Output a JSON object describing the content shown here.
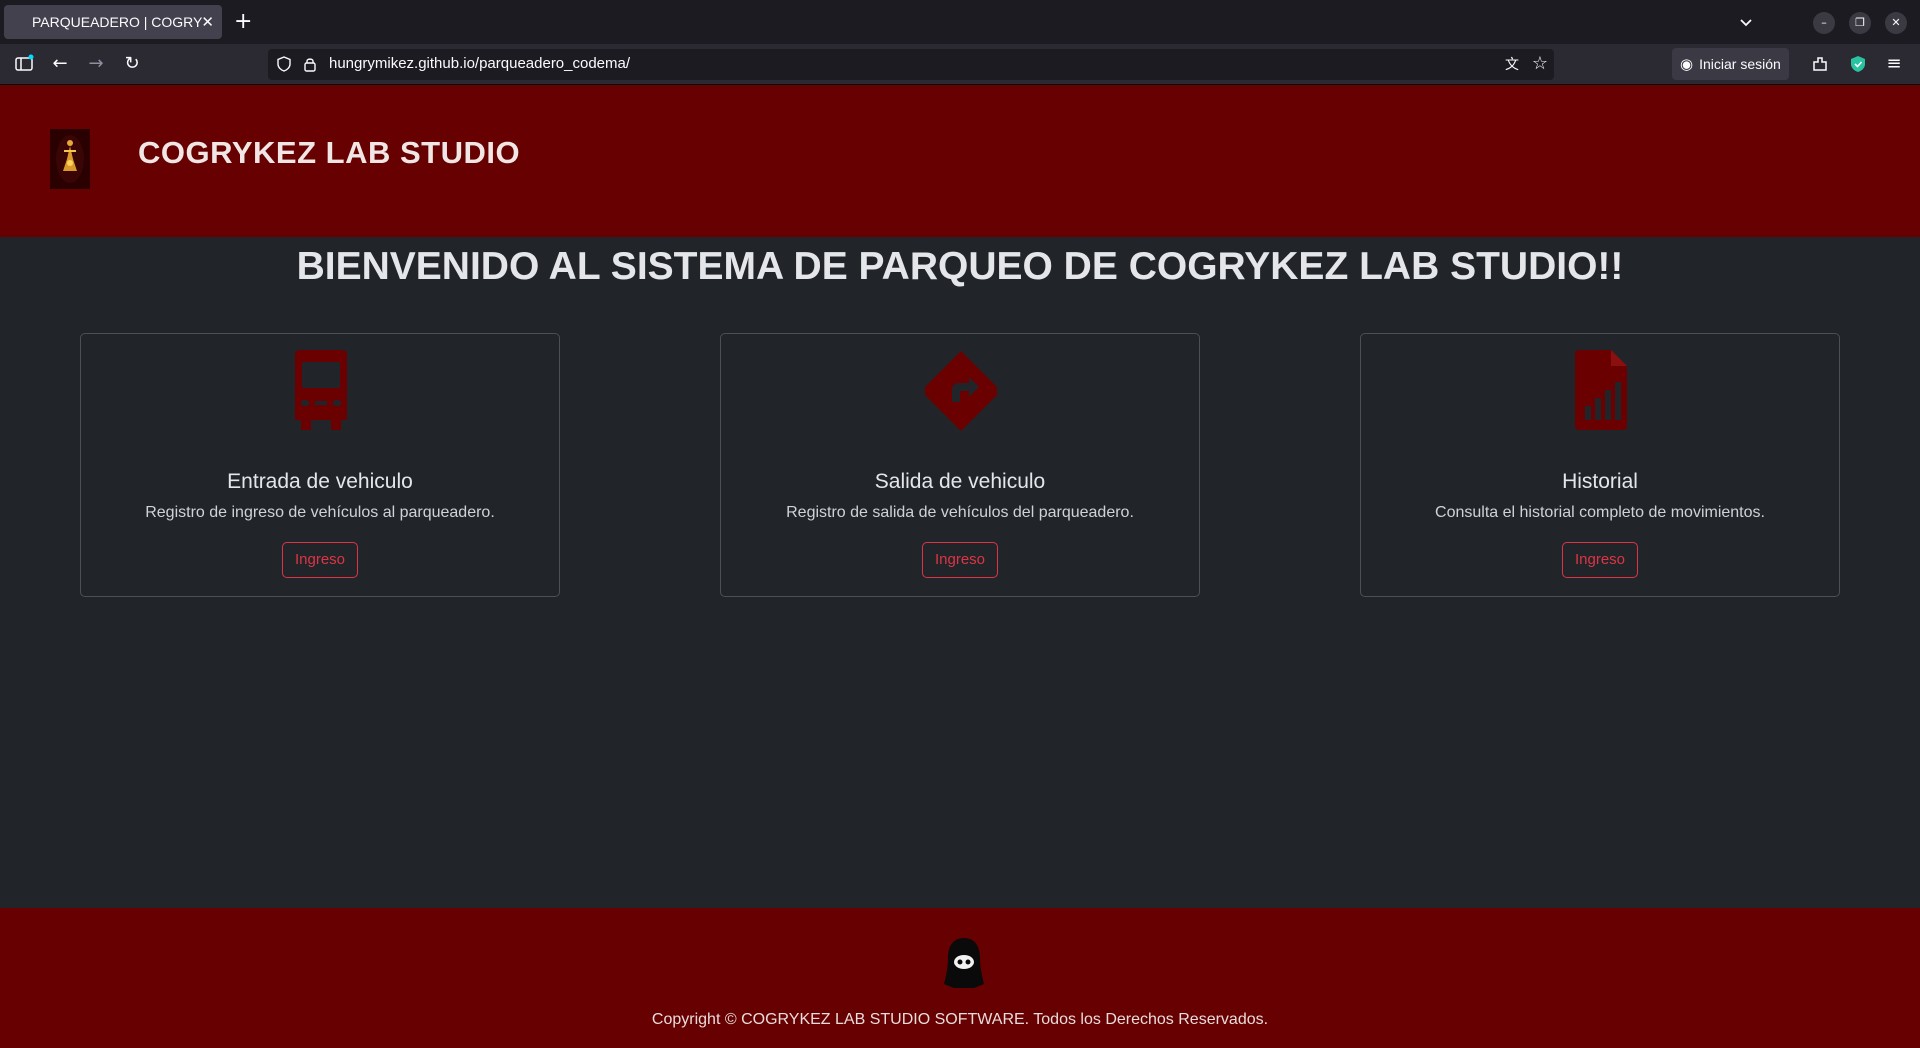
{
  "browser": {
    "tab_title": "PARQUEADERO | COGRYKEZ",
    "url": "hungrymikez.github.io/parqueadero_codema/",
    "signin_label": "Iniciar sesión"
  },
  "header": {
    "brand": "COGRYKEZ LAB STUDIO"
  },
  "main": {
    "welcome": "BIENVENIDO AL SISTEMA DE PARQUEO DE COGRYKEZ LAB STUDIO!!",
    "cards": [
      {
        "icon": "bus-icon",
        "title": "Entrada de vehiculo",
        "description": "Registro de ingreso de vehículos al parqueadero.",
        "button": "Ingreso"
      },
      {
        "icon": "directions-sign-icon",
        "title": "Salida de vehiculo",
        "description": "Registro de salida de vehículos del parqueadero.",
        "button": "Ingreso"
      },
      {
        "icon": "report-document-icon",
        "title": "Historial",
        "description": "Consulta el historial completo de movimientos.",
        "button": "Ingreso"
      }
    ]
  },
  "footer": {
    "copyright": "Copyright © COGRYKEZ LAB STUDIO SOFTWARE. Todos los Derechos Reservados."
  },
  "colors": {
    "header_bg": "#670000",
    "page_bg": "#212529",
    "icon": "#6b0000",
    "button": "#dc3545"
  }
}
